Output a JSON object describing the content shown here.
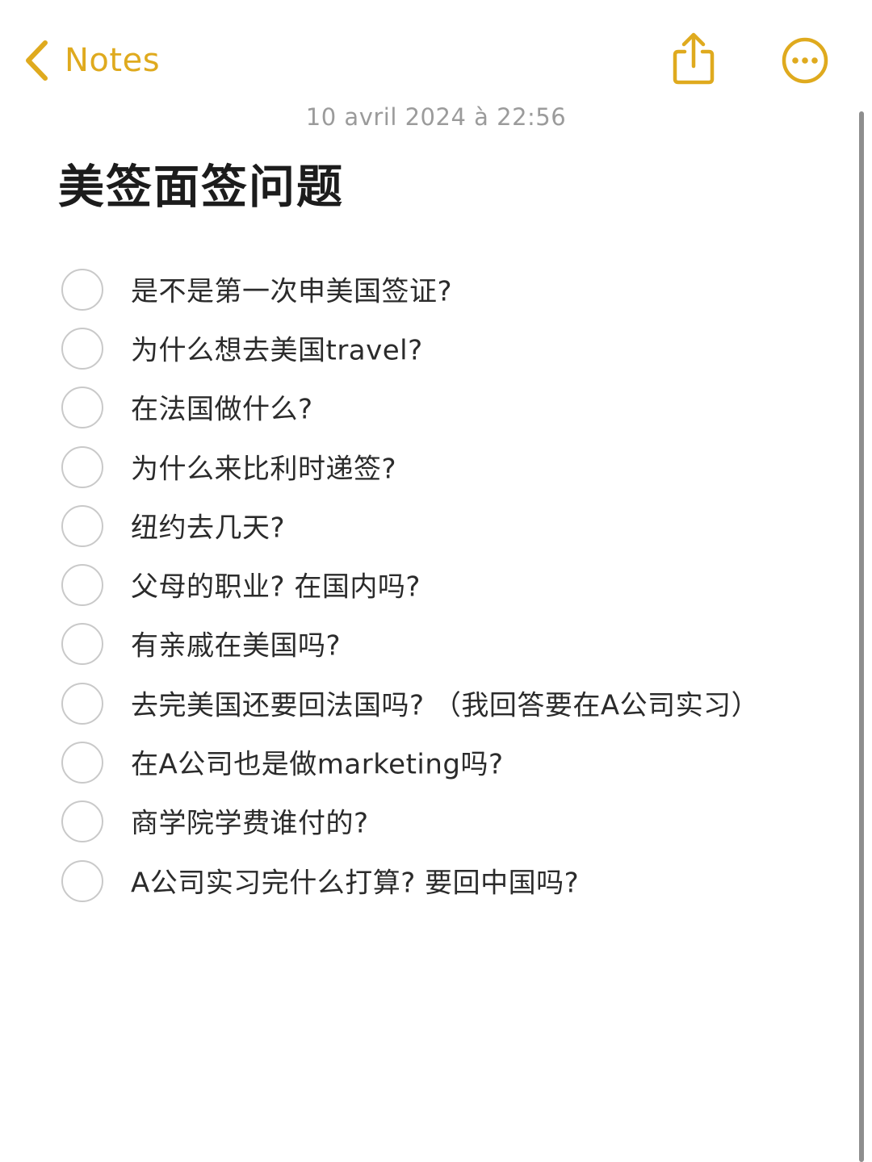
{
  "nav": {
    "back_label": "Notes",
    "back_icon": "chevron-left-icon",
    "share_icon": "share-icon",
    "more_icon": "ellipsis-circle-icon",
    "accent_color": "#dfaa1e"
  },
  "note": {
    "timestamp": "10 avril 2024 à 22:56",
    "title": "美签面签问题",
    "checklist": [
      {
        "text": "是不是第一次申美国签证?",
        "checked": false
      },
      {
        "text": "为什么想去美国travel?",
        "checked": false
      },
      {
        "text": "在法国做什么?",
        "checked": false
      },
      {
        "text": "为什么来比利时递签?",
        "checked": false
      },
      {
        "text": "纽约去几天?",
        "checked": false
      },
      {
        "text": "父母的职业? 在国内吗?",
        "checked": false
      },
      {
        "text": "有亲戚在美国吗?",
        "checked": false
      },
      {
        "text": "去完美国还要回法国吗? （我回答要在A公司实习）",
        "checked": false
      },
      {
        "text": "在A公司也是做marketing吗?",
        "checked": false
      },
      {
        "text": "商学院学费谁付的?",
        "checked": false
      },
      {
        "text": "A公司实习完什么打算? 要回中国吗?",
        "checked": false
      }
    ]
  }
}
